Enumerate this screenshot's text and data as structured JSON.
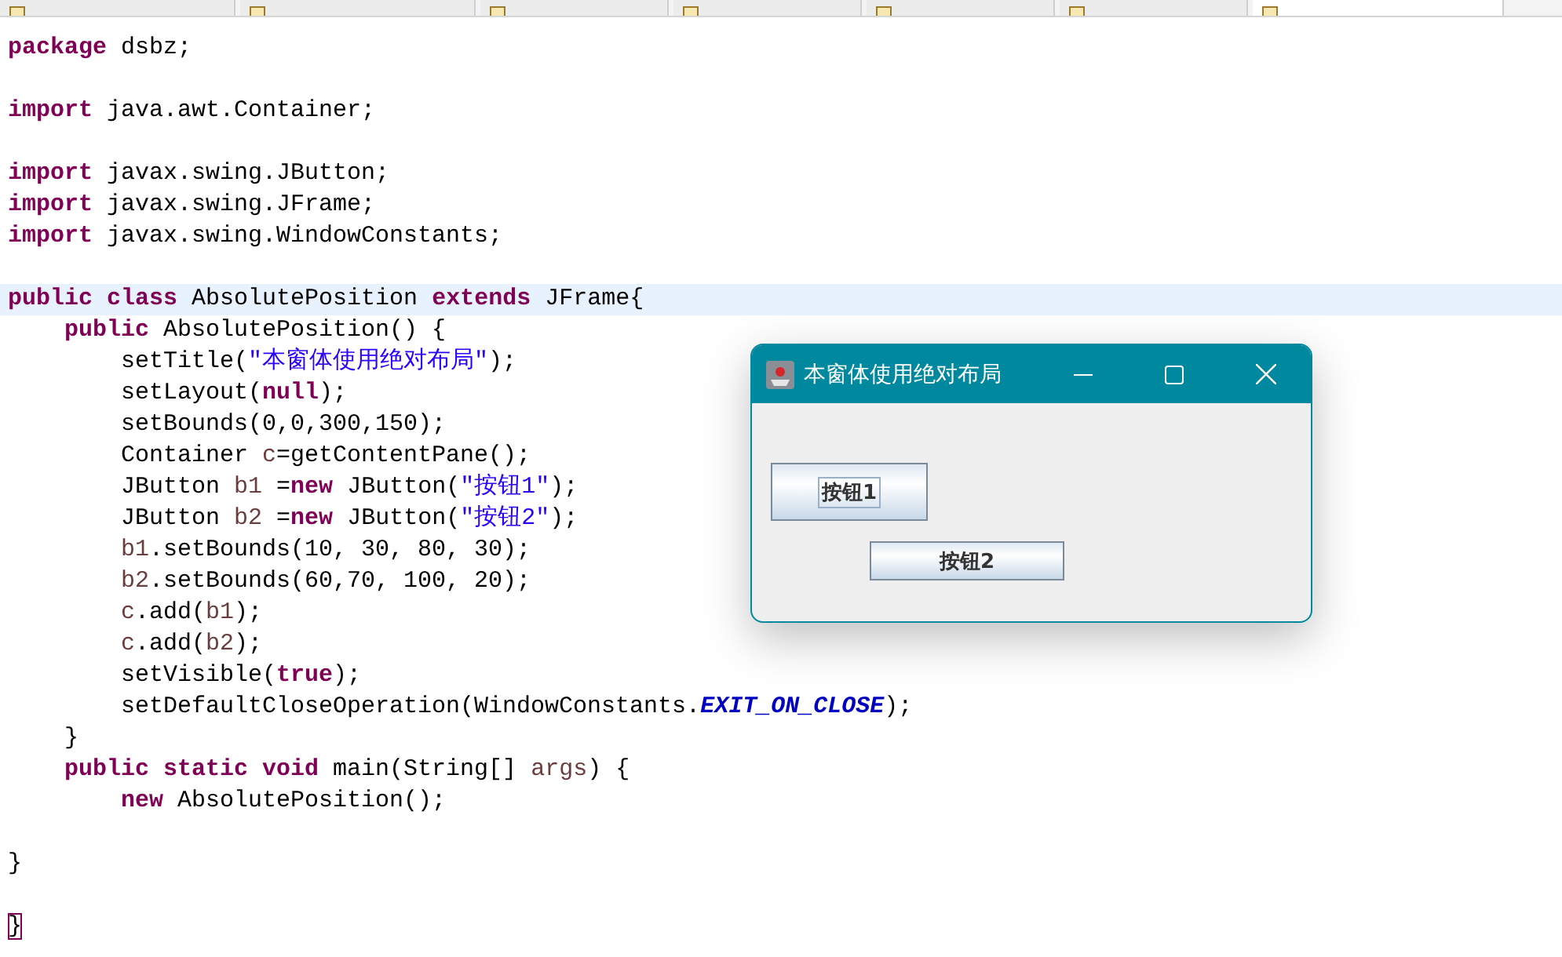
{
  "tabs": [
    {
      "selected": false
    },
    {
      "selected": false
    },
    {
      "selected": false
    },
    {
      "selected": false
    },
    {
      "selected": false
    },
    {
      "selected": false
    },
    {
      "selected": true
    }
  ],
  "editor": {
    "lines": [
      {
        "highlighted": false,
        "tokens": [
          {
            "kind": "kw",
            "text": "package"
          },
          {
            "kind": "plain",
            "text": " dsbz;"
          }
        ]
      },
      {
        "highlighted": false
      },
      {
        "highlighted": false,
        "tokens": [
          {
            "kind": "kw",
            "text": "import"
          },
          {
            "kind": "plain",
            "text": " java.awt.Container;"
          }
        ]
      },
      {
        "highlighted": false
      },
      {
        "highlighted": false,
        "tokens": [
          {
            "kind": "kw",
            "text": "import"
          },
          {
            "kind": "plain",
            "text": " javax.swing.JButton;"
          }
        ]
      },
      {
        "highlighted": false,
        "tokens": [
          {
            "kind": "kw",
            "text": "import"
          },
          {
            "kind": "plain",
            "text": " javax.swing.JFrame;"
          }
        ]
      },
      {
        "highlighted": false,
        "tokens": [
          {
            "kind": "kw",
            "text": "import"
          },
          {
            "kind": "plain",
            "text": " javax.swing.WindowConstants;"
          }
        ]
      },
      {
        "highlighted": false
      },
      {
        "highlighted": true,
        "tokens": [
          {
            "kind": "kw",
            "text": "public class"
          },
          {
            "kind": "plain",
            "text": " AbsolutePosition "
          },
          {
            "kind": "kw",
            "text": "extends"
          },
          {
            "kind": "plain",
            "text": " JFrame{"
          }
        ],
        "children": [
          {
            "highlighted": false,
            "tokens": [
              {
                "kind": "kw",
                "text": "public"
              },
              {
                "kind": "plain",
                "text": " AbsolutePosition() {"
              }
            ],
            "children": [
              {
                "highlighted": false,
                "tokens": [
                  {
                    "kind": "plain",
                    "text": "setTitle("
                  },
                  {
                    "kind": "str",
                    "text": "\"本窗体使用绝对布局\""
                  },
                  {
                    "kind": "plain",
                    "text": ");"
                  }
                ]
              },
              {
                "highlighted": false,
                "tokens": [
                  {
                    "kind": "plain",
                    "text": "setLayout("
                  },
                  {
                    "kind": "kw",
                    "text": "null"
                  },
                  {
                    "kind": "plain",
                    "text": ");"
                  }
                ]
              },
              {
                "highlighted": false,
                "tokens": [
                  {
                    "kind": "plain",
                    "text": "setBounds(0,0,300,150);"
                  }
                ]
              },
              {
                "highlighted": false,
                "tokens": [
                  {
                    "kind": "plain",
                    "text": "Container "
                  },
                  {
                    "kind": "var",
                    "text": "c"
                  },
                  {
                    "kind": "plain",
                    "text": "=getContentPane();"
                  }
                ]
              },
              {
                "highlighted": false,
                "tokens": [
                  {
                    "kind": "plain",
                    "text": "JButton "
                  },
                  {
                    "kind": "var",
                    "text": "b1"
                  },
                  {
                    "kind": "plain",
                    "text": " ="
                  },
                  {
                    "kind": "kw",
                    "text": "new"
                  },
                  {
                    "kind": "plain",
                    "text": " JButton("
                  },
                  {
                    "kind": "str",
                    "text": "\"按钮1\""
                  },
                  {
                    "kind": "plain",
                    "text": ");"
                  }
                ]
              },
              {
                "highlighted": false,
                "tokens": [
                  {
                    "kind": "plain",
                    "text": "JButton "
                  },
                  {
                    "kind": "var",
                    "text": "b2"
                  },
                  {
                    "kind": "plain",
                    "text": " ="
                  },
                  {
                    "kind": "kw",
                    "text": "new"
                  },
                  {
                    "kind": "plain",
                    "text": " JButton("
                  },
                  {
                    "kind": "str",
                    "text": "\"按钮2\""
                  },
                  {
                    "kind": "plain",
                    "text": ");"
                  }
                ]
              },
              {
                "highlighted": false,
                "tokens": [
                  {
                    "kind": "var",
                    "text": "b1"
                  },
                  {
                    "kind": "plain",
                    "text": ".setBounds(10, 30, 80, 30);"
                  }
                ]
              },
              {
                "highlighted": false,
                "tokens": [
                  {
                    "kind": "var",
                    "text": "b2"
                  },
                  {
                    "kind": "plain",
                    "text": ".setBounds(60,70, 100, 20);"
                  }
                ]
              },
              {
                "highlighted": false,
                "tokens": [
                  {
                    "kind": "var",
                    "text": "c"
                  },
                  {
                    "kind": "plain",
                    "text": ".add("
                  },
                  {
                    "kind": "var",
                    "text": "b1"
                  },
                  {
                    "kind": "plain",
                    "text": ");"
                  }
                ]
              },
              {
                "highlighted": false,
                "tokens": [
                  {
                    "kind": "var",
                    "text": "c"
                  },
                  {
                    "kind": "plain",
                    "text": ".add("
                  },
                  {
                    "kind": "var",
                    "text": "b2"
                  },
                  {
                    "kind": "plain",
                    "text": ");"
                  }
                ]
              },
              {
                "highlighted": false,
                "tokens": [
                  {
                    "kind": "plain",
                    "text": "setVisible("
                  },
                  {
                    "kind": "kw",
                    "text": "true"
                  },
                  {
                    "kind": "plain",
                    "text": ");"
                  }
                ]
              },
              {
                "highlighted": false,
                "tokens": [
                  {
                    "kind": "plain",
                    "text": "setDefaultCloseOperation(WindowConstants."
                  },
                  {
                    "kind": "field",
                    "text": "EXIT_ON_CLOSE"
                  },
                  {
                    "kind": "plain",
                    "text": ");"
                  }
                ]
              }
            ]
          },
          {
            "highlighted": false,
            "tokens": [
              {
                "kind": "plain",
                "text": "}"
              }
            ]
          },
          {
            "highlighted": false,
            "tokens": [
              {
                "kind": "kw",
                "text": "public static void"
              },
              {
                "kind": "plain",
                "text": " main(String[] "
              },
              {
                "kind": "var",
                "text": "args"
              },
              {
                "kind": "plain",
                "text": ") {"
              }
            ],
            "children": [
              {
                "highlighted": false,
                "tokens": [
                  {
                    "kind": "kw",
                    "text": "new"
                  },
                  {
                    "kind": "plain",
                    "text": " AbsolutePosition();"
                  }
                ]
              }
            ]
          },
          {
            "highlighted": false
          }
        ]
      },
      {
        "highlighted": false,
        "tokens": [
          {
            "kind": "plain",
            "text": "}"
          }
        ]
      },
      {
        "highlighted": false
      },
      {
        "highlighted": false,
        "tokens": [
          {
            "kind": "matched",
            "text": "}"
          }
        ]
      }
    ]
  },
  "dialog": {
    "title": "本窗体使用绝对布局",
    "buttons": [
      {
        "label": "按钮1",
        "focused": true
      },
      {
        "label": "按钮2",
        "focused": false
      }
    ]
  }
}
